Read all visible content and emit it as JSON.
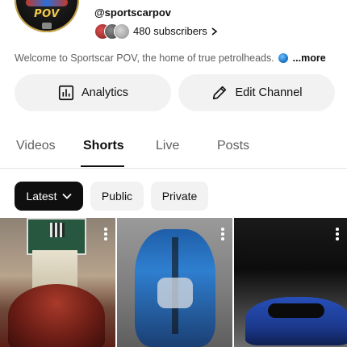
{
  "channel": {
    "avatar_text": "POV",
    "handle": "@sportscarpov",
    "subscribers": "480 subscribers",
    "description": "Welcome to Sportscar POV, the home of true petrolheads.",
    "description_more": "...more"
  },
  "actions": {
    "analytics_label": "Analytics",
    "edit_label": "Edit Channel"
  },
  "tabs": [
    {
      "label": "Videos",
      "active": false
    },
    {
      "label": "Shorts",
      "active": true
    },
    {
      "label": "Live",
      "active": false
    },
    {
      "label": "Posts",
      "active": false
    }
  ],
  "filters": [
    {
      "label": "Latest",
      "selected": true
    },
    {
      "label": "Public",
      "selected": false
    },
    {
      "label": "Private",
      "selected": false
    }
  ],
  "shorts": [
    {
      "icon": "more-vert-icon"
    },
    {
      "icon": "more-vert-icon"
    },
    {
      "icon": "more-vert-icon"
    }
  ],
  "colors": {
    "chip_selected_bg": "#0f0f0f",
    "chip_bg": "#f2f2f2",
    "text_primary": "#0f0f0f",
    "text_secondary": "#606060"
  }
}
